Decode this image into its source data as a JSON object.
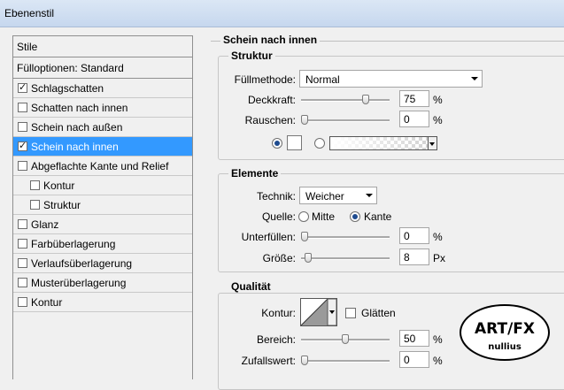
{
  "window": {
    "title": "Ebenenstil"
  },
  "styles_list": {
    "header": "Stile",
    "blend_options": "Fülloptionen: Standard",
    "items": [
      {
        "label": "Schlagschatten",
        "checked": true,
        "selected": false,
        "indent": false
      },
      {
        "label": "Schatten nach innen",
        "checked": false,
        "selected": false,
        "indent": false
      },
      {
        "label": "Schein nach außen",
        "checked": false,
        "selected": false,
        "indent": false
      },
      {
        "label": "Schein nach innen",
        "checked": true,
        "selected": true,
        "indent": false
      },
      {
        "label": "Abgeflachte Kante und Relief",
        "checked": false,
        "selected": false,
        "indent": false
      },
      {
        "label": "Kontur",
        "checked": false,
        "selected": false,
        "indent": true
      },
      {
        "label": "Struktur",
        "checked": false,
        "selected": false,
        "indent": true
      },
      {
        "label": "Glanz",
        "checked": false,
        "selected": false,
        "indent": false
      },
      {
        "label": "Farbüberlagerung",
        "checked": false,
        "selected": false,
        "indent": false
      },
      {
        "label": "Verlaufsüberlagerung",
        "checked": false,
        "selected": false,
        "indent": false
      },
      {
        "label": "Musterüberlagerung",
        "checked": false,
        "selected": false,
        "indent": false
      },
      {
        "label": "Kontur",
        "checked": false,
        "selected": false,
        "indent": false
      }
    ]
  },
  "panel": {
    "title": "Schein nach innen",
    "structure": {
      "title": "Struktur",
      "blend_mode_label": "Füllmethode:",
      "blend_mode_value": "Normal",
      "opacity_label": "Deckkraft:",
      "opacity_value": "75",
      "opacity_unit": "%",
      "opacity_level": 0.75,
      "noise_label": "Rauschen:",
      "noise_value": "0",
      "noise_unit": "%",
      "noise_level": 0,
      "color_mode": "solid-color",
      "glow_color": "#ffffff"
    },
    "elements": {
      "title": "Elemente",
      "technique_label": "Technik:",
      "technique_value": "Weicher",
      "source_label": "Quelle:",
      "source_center": "Mitte",
      "source_edge": "Kante",
      "source_selected": "Kante",
      "choke_label": "Unterfüllen:",
      "choke_value": "0",
      "choke_unit": "%",
      "choke_level": 0,
      "size_label": "Größe:",
      "size_value": "8",
      "size_unit": "Px",
      "size_level": 0.04
    },
    "quality": {
      "title": "Qualität",
      "contour_label": "Kontur:",
      "antialias_label": "Glätten",
      "antialias_checked": false,
      "range_label": "Bereich:",
      "range_value": "50",
      "range_unit": "%",
      "range_level": 0.5,
      "jitter_label": "Zufallswert:",
      "jitter_value": "0",
      "jitter_unit": "%",
      "jitter_level": 0
    }
  },
  "watermark": {
    "line1": "ART/FX",
    "line2": "nullius"
  }
}
